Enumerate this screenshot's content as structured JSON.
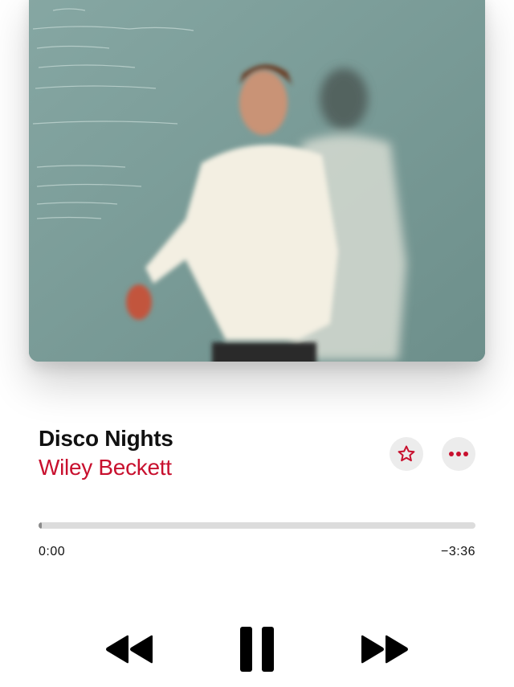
{
  "artwork": {
    "icon": "album-artwork"
  },
  "track": {
    "title": "Disco Nights",
    "artist": "Wiley Beckett"
  },
  "actions": {
    "favorite_icon": "star-icon",
    "more_icon": "ellipsis-icon"
  },
  "playback": {
    "elapsed": "0:00",
    "remaining": "−3:36",
    "progress": 0.0
  },
  "controls": {
    "rewind_icon": "rewind-icon",
    "pause_icon": "pause-icon",
    "forward_icon": "fast-forward-icon"
  },
  "colors": {
    "accent": "#c8102e",
    "text": "#111111",
    "button_bg": "#ececec",
    "track_bg": "#dcdcdc"
  }
}
